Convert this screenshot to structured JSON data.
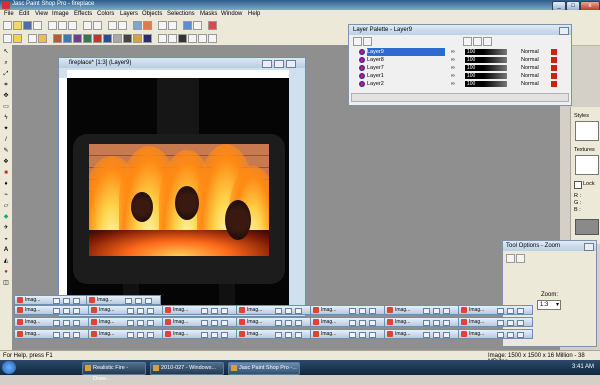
{
  "app": {
    "title": "Jasc Paint Shop Pro - fireplace",
    "minimize": "_",
    "maximize": "□",
    "close": "x"
  },
  "menu": [
    "File",
    "Edit",
    "View",
    "Image",
    "Effects",
    "Colors",
    "Layers",
    "Objects",
    "Selections",
    "Masks",
    "Window",
    "Help"
  ],
  "image_window": {
    "title": "fireplace* [1:3] (Layer9)"
  },
  "layer_palette": {
    "title": "Layer Palette - Layer9",
    "layers": [
      {
        "name": "Layer9",
        "opacity": "100",
        "blend": "Normal",
        "selected": true
      },
      {
        "name": "Layer8",
        "opacity": "100",
        "blend": "Normal",
        "selected": false
      },
      {
        "name": "Layer7",
        "opacity": "100",
        "blend": "Normal",
        "selected": false
      },
      {
        "name": "Layer1",
        "opacity": "100",
        "blend": "Normal",
        "selected": false
      },
      {
        "name": "Layer2",
        "opacity": "100",
        "blend": "Normal",
        "selected": false
      }
    ]
  },
  "materials": {
    "styles": "Styles",
    "textures": "Textures",
    "lock": "Lock",
    "r": "R :",
    "g": "G :",
    "b": "B :"
  },
  "tool_options": {
    "title": "Tool Options - Zoom",
    "zoom_label": "Zoom:",
    "zoom_value": "1:3"
  },
  "minimized": {
    "label": "Imag..."
  },
  "status": {
    "left": "For Help, press F1",
    "right": "Image: 1500 x 1500 x 16 Million - 38 MBytes"
  },
  "taskbar": {
    "tasks": [
      "Realistic Fire - Draw...",
      "2010-027 - Windows...",
      "Jasc Paint Shop Pro -..."
    ],
    "clock": "3:41 AM"
  },
  "colors": {
    "title_bar": "#2c5d8a",
    "workspace": "#8f8f8f",
    "delete_red": "#c21111"
  }
}
